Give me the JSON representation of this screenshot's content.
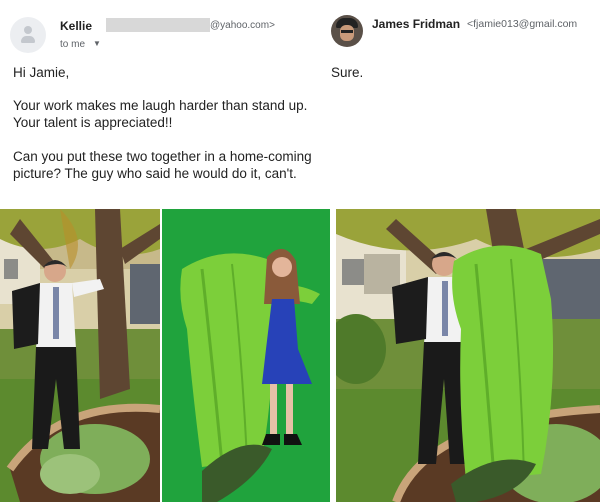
{
  "left_email": {
    "sender_name": "Kellie",
    "sender_email_domain": "@yahoo.com>",
    "recipient_label": "to me",
    "greeting": "Hi Jamie,",
    "paragraph_1": "Your work makes me laugh harder than stand up. Your talent is appreciated!!",
    "paragraph_2": "Can you put these two together in a home-coming picture? The guy who said he would do it, can't."
  },
  "right_email": {
    "sender_name": "James Fridman",
    "sender_email": "<fjamie013@gmail.com",
    "body": "Sure."
  },
  "icons": {
    "default_avatar": "person-avatar-icon",
    "recipient_dropdown": "chevron-down-icon"
  },
  "colors": {
    "green_screen": "#1e9e3a",
    "drape": "#7ccf3a"
  }
}
